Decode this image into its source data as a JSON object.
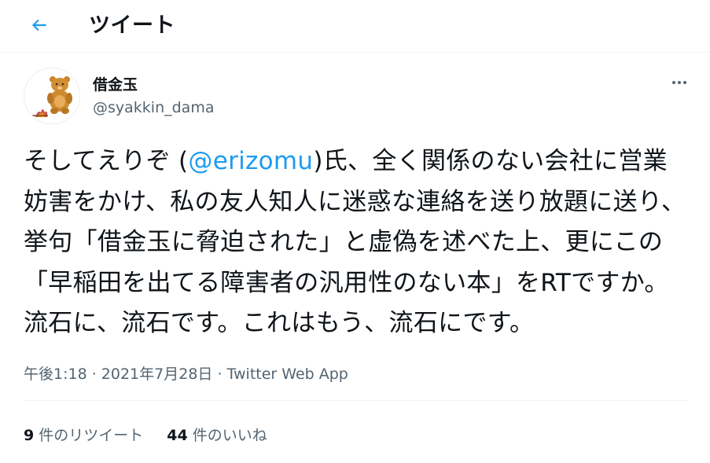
{
  "header": {
    "title": "ツイート",
    "back_icon": "arrow-left-icon",
    "accent_color": "#1d9bf0"
  },
  "user": {
    "display_name": "借金玉",
    "handle": "@syakkin_dama",
    "avatar_icon": "bear-avatar"
  },
  "tweet": {
    "text_before": "そしてえりぞ (",
    "mention": "@erizomu",
    "text_after": ")氏、全く関係のない会社に営業妨害をかけ、私の友人知人に迷惑な連絡を送り放題に送り、挙句「借金玉に脅迫された」と虚偽を述べた上、更にこの「早稲田を出てる障害者の汎用性のない本」をRTですか。流石に、流石です。これはもう、流石にです。"
  },
  "meta": {
    "time": "午後1:18",
    "separator": " · ",
    "date": "2021年7月28日",
    "source": "Twitter Web App"
  },
  "stats": {
    "retweets_count": "9",
    "retweets_label": " 件のリツイート",
    "likes_count": "44",
    "likes_label": " 件のいいね"
  },
  "more_icon": "more-horizontal-icon"
}
